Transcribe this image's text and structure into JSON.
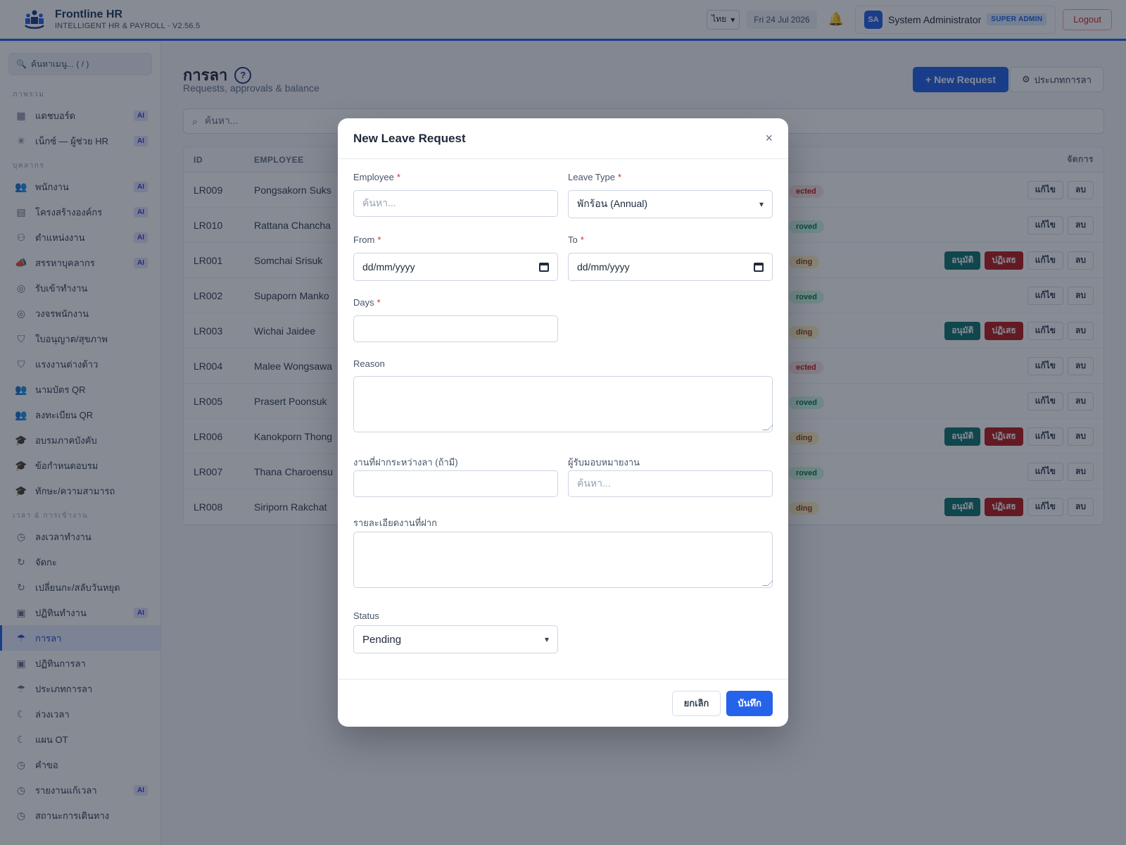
{
  "header": {
    "brand_name": "Frontline HR",
    "brand_sub": "INTELLIGENT HR & PAYROLL · V2.56.5",
    "language": "ไทย",
    "date": "Fri 24 Jul 2026",
    "user_initials": "SA",
    "user_name": "System Administrator",
    "role": "SUPER ADMIN",
    "logout_label": "Logout"
  },
  "sidebar": {
    "search_placeholder": "ค้นหาเมนู... ( / )",
    "sections": [
      {
        "title": "ภาพรวม",
        "items": [
          {
            "label": "แดชบอร์ด",
            "icon": "grid-icon",
            "ai": "AI"
          },
          {
            "label": "เน็กซ์ — ผู้ช่วย HR",
            "icon": "sparkle-icon",
            "ai": "AI"
          }
        ]
      },
      {
        "title": "บุคลากร",
        "items": [
          {
            "label": "พนักงาน",
            "icon": "users-icon",
            "ai": "AI"
          },
          {
            "label": "โครงสร้างองค์กร",
            "icon": "building-icon",
            "ai": "AI"
          },
          {
            "label": "ตำแหน่งงาน",
            "icon": "org-chart-icon",
            "ai": "AI"
          },
          {
            "label": "สรรหาบุคลากร",
            "icon": "megaphone-icon",
            "ai": "AI"
          },
          {
            "label": "รับเข้าทำงาน",
            "icon": "compass-icon",
            "ai": ""
          },
          {
            "label": "วงจรพนักงาน",
            "icon": "compass-icon",
            "ai": ""
          },
          {
            "label": "ใบอนุญาต/สุขภาพ",
            "icon": "shield-icon",
            "ai": ""
          },
          {
            "label": "แรงงานต่างด้าว",
            "icon": "shield-icon",
            "ai": ""
          },
          {
            "label": "นามบัตร QR",
            "icon": "users-icon",
            "ai": ""
          },
          {
            "label": "ลงทะเบียน QR",
            "icon": "users-icon",
            "ai": ""
          },
          {
            "label": "อบรมภาคบังคับ",
            "icon": "graduation-cap-icon",
            "ai": ""
          },
          {
            "label": "ข้อกำหนดอบรม",
            "icon": "graduation-cap-icon",
            "ai": ""
          },
          {
            "label": "ทักษะ/ความสามารถ",
            "icon": "graduation-cap-icon",
            "ai": ""
          }
        ]
      },
      {
        "title": "เวลา & การเข้างาน",
        "items": [
          {
            "label": "ลงเวลาทำงาน",
            "icon": "clock-icon",
            "ai": ""
          },
          {
            "label": "จัดกะ",
            "icon": "refresh-icon",
            "ai": ""
          },
          {
            "label": "เปลี่ยนกะ/สลับวันหยุด",
            "icon": "refresh-icon",
            "ai": ""
          },
          {
            "label": "ปฏิทินทำงาน",
            "icon": "calendar-icon",
            "ai": "AI"
          },
          {
            "label": "การลา",
            "icon": "umbrella-icon",
            "ai": "",
            "active": true
          },
          {
            "label": "ปฏิทินการลา",
            "icon": "calendar-icon",
            "ai": ""
          },
          {
            "label": "ประเภทการลา",
            "icon": "umbrella-icon",
            "ai": ""
          },
          {
            "label": "ล่วงเวลา",
            "icon": "moon-icon",
            "ai": ""
          },
          {
            "label": "แผน OT",
            "icon": "moon-icon",
            "ai": ""
          },
          {
            "label": "คำขอ",
            "icon": "clock-icon",
            "ai": ""
          },
          {
            "label": "รายงานแก้เวลา",
            "icon": "clock-icon",
            "ai": "AI"
          },
          {
            "label": "สถานะการเดินทาง",
            "icon": "clock-icon",
            "ai": ""
          }
        ]
      }
    ]
  },
  "main": {
    "title": "การลา",
    "subtitle": "Requests, approvals & balance",
    "new_request_label": "+ New Request",
    "leave_types_label": "ประเภทการลา",
    "search_placeholder": "ค้นหา...",
    "table": {
      "columns": {
        "id": "ID",
        "employee": "EMPLOYEE",
        "actions": "จัดการ"
      },
      "rows": [
        {
          "id": "LR009",
          "employee": "Pongsakorn Suks",
          "status": "ected",
          "status_type": "rejected",
          "actions": false
        },
        {
          "id": "LR010",
          "employee": "Rattana Chancha",
          "status": "roved",
          "status_type": "approved",
          "actions": false
        },
        {
          "id": "LR001",
          "employee": "Somchai Srisuk",
          "status": "ding",
          "status_type": "pending",
          "actions": true
        },
        {
          "id": "LR002",
          "employee": "Supaporn Manko",
          "status": "roved",
          "status_type": "approved",
          "actions": false
        },
        {
          "id": "LR003",
          "employee": "Wichai Jaidee",
          "status": "ding",
          "status_type": "pending",
          "actions": true
        },
        {
          "id": "LR004",
          "employee": "Malee Wongsawa",
          "status": "ected",
          "status_type": "rejected",
          "actions": false
        },
        {
          "id": "LR005",
          "employee": "Prasert Poonsuk",
          "status": "roved",
          "status_type": "approved",
          "actions": false
        },
        {
          "id": "LR006",
          "employee": "Kanokporn Thong",
          "status": "ding",
          "status_type": "pending",
          "actions": true
        },
        {
          "id": "LR007",
          "employee": "Thana Charoensu",
          "status": "roved",
          "status_type": "approved",
          "actions": false
        },
        {
          "id": "LR008",
          "employee": "Siriporn Rakchat",
          "status": "ding",
          "status_type": "pending",
          "actions": true
        }
      ],
      "approve_label": "อนุมัติ",
      "reject_label": "ปฏิเสธ",
      "edit_label": "แก้ไข",
      "delete_label": "ลบ"
    }
  },
  "modal": {
    "title": "New Leave Request",
    "close": "×",
    "employee_label": "Employee",
    "employee_placeholder": "ค้นหา...",
    "leave_type_label": "Leave Type",
    "leave_type_value": "พักร้อน (Annual)",
    "from_label": "From",
    "from_placeholder": "dd/mm/yyyy",
    "to_label": "To",
    "to_placeholder": "dd/mm/yyyy",
    "days_label": "Days",
    "reason_label": "Reason",
    "handover_label": "งานที่ฝากระหว่างลา (ถ้ามี)",
    "assignee_label": "ผู้รับมอบหมายงาน",
    "assignee_placeholder": "ค้นหา...",
    "details_label": "รายละเอียดงานที่ฝาก",
    "status_label": "Status",
    "status_value": "Pending",
    "required_mark": "*",
    "cancel_label": "ยกเลิก",
    "save_label": "บันทึก"
  }
}
